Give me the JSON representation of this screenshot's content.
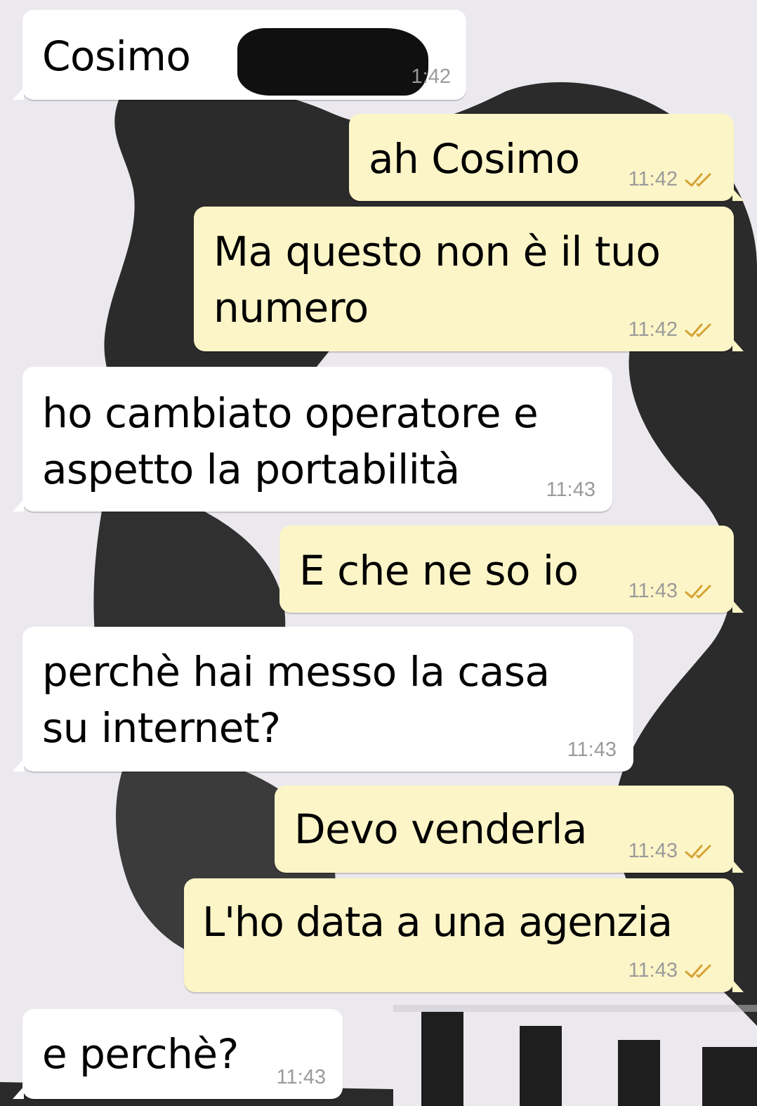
{
  "colors": {
    "incoming_bubble": "#ffffff",
    "outgoing_bubble": "#fcf5c7",
    "timestamp": "#9a9a9a",
    "read_ticks": "#d6a236"
  },
  "messages": [
    {
      "direction": "in",
      "text": "Cosimo",
      "time": "1:42",
      "redacted": true
    },
    {
      "direction": "out",
      "text": "ah Cosimo",
      "time": "11:42",
      "status": "read"
    },
    {
      "direction": "out",
      "text_lines": [
        "Ma questo non è il tuo",
        "numero"
      ],
      "time": "11:42",
      "status": "read"
    },
    {
      "direction": "in",
      "text_lines": [
        "ho cambiato operatore e",
        "aspetto la portabilità"
      ],
      "time": "11:43"
    },
    {
      "direction": "out",
      "text": "E che ne so io",
      "time": "11:43",
      "status": "read"
    },
    {
      "direction": "in",
      "text_lines": [
        "perchè hai messo la casa",
        "su internet?"
      ],
      "time": "11:43"
    },
    {
      "direction": "out",
      "text": "Devo venderla",
      "time": "11:43",
      "status": "read"
    },
    {
      "direction": "out",
      "text": "L'ho data a una agenzia",
      "time": "11:43",
      "status": "read"
    },
    {
      "direction": "in",
      "text": "e perchè?",
      "time": "11:43"
    }
  ]
}
